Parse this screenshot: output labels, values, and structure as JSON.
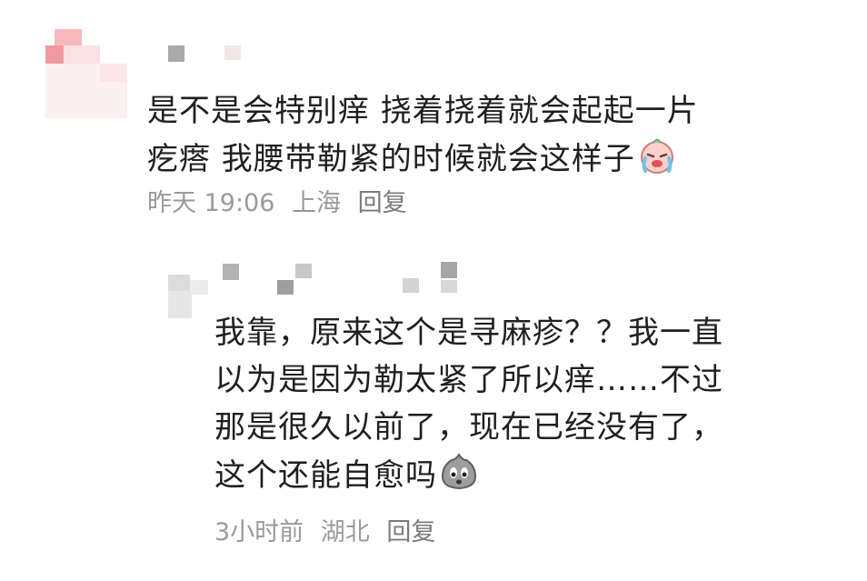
{
  "comment": {
    "text_line1": "是不是会特别痒 挠着挠着就会起起一片",
    "text_line2": "疙瘩 我腰带勒紧的时候就会这样子",
    "emoji": "crying-face-emoji",
    "time": "昨天 19:06",
    "location": "上海",
    "reply_label": "回复"
  },
  "reply": {
    "text_line1": "我靠，原来这个是寻麻疹？？我一直",
    "text_line2": "以为是因为勒太紧了所以痒……不过",
    "text_line3": "那是很久以前了，现在已经没有了，",
    "text_line4": "这个还能自愈吗",
    "emoji": "worried-blob-emoji",
    "time": "3小时前",
    "location": "湖北",
    "reply_label": "回复"
  },
  "colors": {
    "text": "#1f1f1f",
    "meta": "#9a9a9a",
    "mosaic_pink": "#f5a7ad",
    "mosaic_gray": "#b0b0b0"
  }
}
